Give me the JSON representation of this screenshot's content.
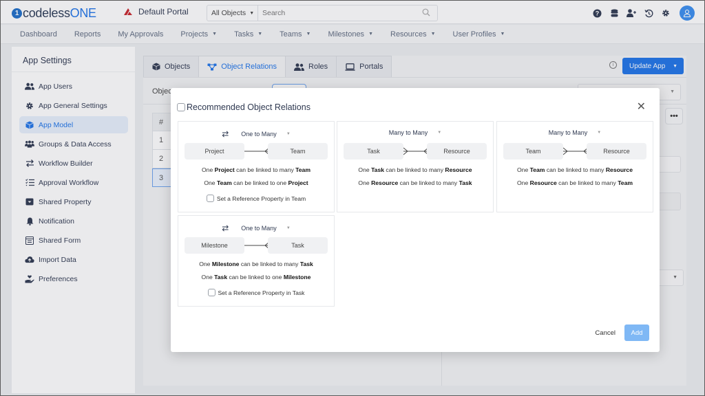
{
  "header": {
    "logo_prefix": "codeless",
    "logo_suffix": "ONE",
    "portal_name": "Default Portal",
    "search_scope": "All Objects",
    "search_placeholder": "Search",
    "icons": [
      "help-icon",
      "database-icon",
      "add-user-icon",
      "history-icon",
      "gear-icon",
      "user-avatar-icon"
    ]
  },
  "nav": {
    "items": [
      {
        "label": "Dashboard",
        "dropdown": false
      },
      {
        "label": "Reports",
        "dropdown": false
      },
      {
        "label": "My Approvals",
        "dropdown": false
      },
      {
        "label": "Projects",
        "dropdown": true
      },
      {
        "label": "Tasks",
        "dropdown": true
      },
      {
        "label": "Teams",
        "dropdown": true
      },
      {
        "label": "Milestones",
        "dropdown": true
      },
      {
        "label": "Resources",
        "dropdown": true
      },
      {
        "label": "User Profiles",
        "dropdown": true
      }
    ]
  },
  "sidebar": {
    "title": "App Settings",
    "items": [
      {
        "label": "App Users",
        "icon": "users-icon"
      },
      {
        "label": "App General Settings",
        "icon": "gear-icon"
      },
      {
        "label": "App Model",
        "icon": "cube-icon",
        "active": true
      },
      {
        "label": "Groups & Data Access",
        "icon": "groups-icon"
      },
      {
        "label": "Workflow Builder",
        "icon": "exchange-icon"
      },
      {
        "label": "Approval Workflow",
        "icon": "checklist-icon"
      },
      {
        "label": "Shared Property",
        "icon": "inbox-icon"
      },
      {
        "label": "Notification",
        "icon": "bell-icon"
      },
      {
        "label": "Shared Form",
        "icon": "form-icon"
      },
      {
        "label": "Import Data",
        "icon": "cloud-upload-icon"
      },
      {
        "label": "Preferences",
        "icon": "hand-heart-icon"
      }
    ]
  },
  "main": {
    "tabs": [
      {
        "label": "Objects",
        "icon": "cube-icon"
      },
      {
        "label": "Object Relations",
        "icon": "relations-icon",
        "active": true
      },
      {
        "label": "Roles",
        "icon": "users-icon"
      },
      {
        "label": "Portals",
        "icon": "laptop-icon"
      }
    ],
    "update_button": "Update App",
    "subbar_label": "Objec",
    "table": {
      "header": "#",
      "rows": [
        "1",
        "2",
        "3"
      ],
      "selected_row": "3"
    },
    "more_label": "•••"
  },
  "modal": {
    "title": "Recommended Object Relations",
    "close_label": "✕",
    "relations": [
      {
        "type": "One to Many",
        "show_switch": true,
        "left": "Project",
        "right": "Team",
        "line1": {
          "pre": "One ",
          "a": "Project",
          "mid": " can be linked to many ",
          "b": "Team"
        },
        "line2": {
          "pre": "One ",
          "a": "Team",
          "mid": " can be linked to one ",
          "b": "Project"
        },
        "reference": "Set a Reference Property in Team"
      },
      {
        "type": "Many to Many",
        "show_switch": false,
        "left": "Task",
        "right": "Resource",
        "line1": {
          "pre": "One ",
          "a": "Task",
          "mid": " can be linked to many ",
          "b": "Resource"
        },
        "line2": {
          "pre": "One ",
          "a": "Resource",
          "mid": " can be linked to many ",
          "b": "Task"
        }
      },
      {
        "type": "Many to Many",
        "show_switch": false,
        "left": "Team",
        "right": "Resource",
        "line1": {
          "pre": "One ",
          "a": "Team",
          "mid": " can be linked to many ",
          "b": "Resource"
        },
        "line2": {
          "pre": "One ",
          "a": "Resource",
          "mid": " can be linked to many ",
          "b": "Team"
        }
      },
      {
        "type": "One to Many",
        "show_switch": true,
        "left": "Milestone",
        "right": "Task",
        "line1": {
          "pre": "One ",
          "a": "Milestone",
          "mid": " can be linked to many ",
          "b": "Task"
        },
        "line2": {
          "pre": "One ",
          "a": "Task",
          "mid": " can be linked to one ",
          "b": "Milestone"
        },
        "reference": "Set a Reference Property in Task"
      }
    ],
    "cancel_label": "Cancel",
    "add_label": "Add"
  },
  "colors": {
    "accent": "#1e73e8",
    "add_disabled": "#7fb8f5",
    "portal_logo": "#c8252c"
  }
}
